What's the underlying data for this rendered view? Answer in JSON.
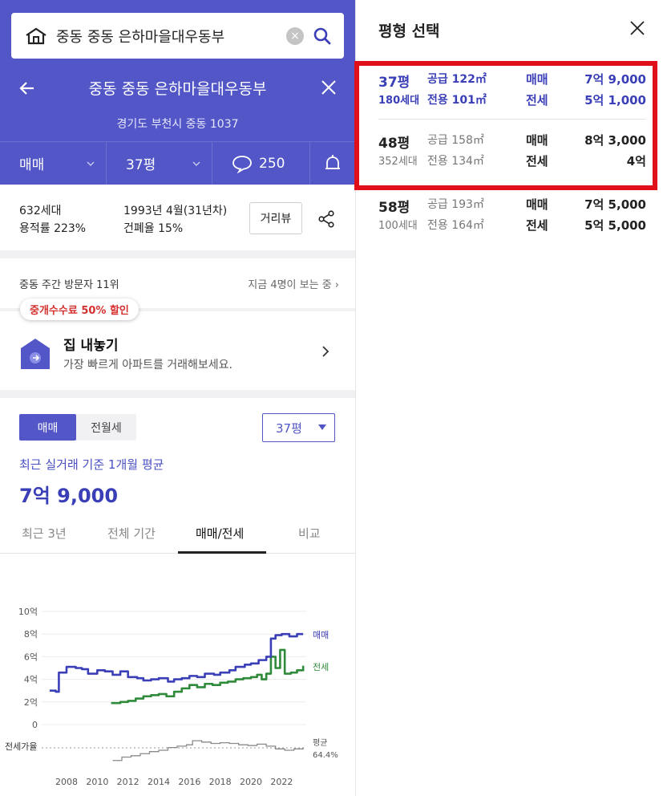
{
  "search": {
    "value": "중동 중동 은하마을대우동부",
    "clear_icon": "×"
  },
  "header": {
    "title": "중동 중동 은하마을대우동부",
    "address": "경기도 부천시 중동 1037"
  },
  "filters": {
    "trade": "매매",
    "size": "평",
    "size_num": "37",
    "comments": "250"
  },
  "complex_info": {
    "households": "632세대",
    "far": "용적률 223%",
    "built": "1993년 4월(31년차)",
    "bcr": "건폐율 15%",
    "street_view": "거리뷰"
  },
  "visitors": {
    "weekly": "중동 주간 방문자 11위",
    "now": "지금 4명이 보는 중"
  },
  "promo": {
    "badge": "중개수수료 50% 할인",
    "title": "집 내놓기",
    "subtitle": "가장 빠르게 아파트를 거래해보세요."
  },
  "market": {
    "seg_active": "매매",
    "seg_other": "전월세",
    "pyeong_select": "37평",
    "avg_label": "최근 실거래 기준 1개월 평균",
    "avg_price": "7억 9,000",
    "tabs": [
      "최근 3년",
      "전체 기간",
      "매매/전세",
      "비교"
    ]
  },
  "chart_data": {
    "type": "line",
    "y_ticks": [
      "10억",
      "8억",
      "6억",
      "4억",
      "2억",
      "0"
    ],
    "x_ticks": [
      "2008",
      "2010",
      "2012",
      "2014",
      "2016",
      "2018",
      "2020",
      "2022"
    ],
    "ylim": [
      0,
      10
    ],
    "xlim": [
      2006.8,
      2023.6
    ],
    "series": [
      {
        "name": "매매",
        "color": "#3b3fb7",
        "x": [
          2006.9,
          2007.3,
          2007.5,
          2008.0,
          2008.6,
          2009.0,
          2009.4,
          2010.0,
          2010.5,
          2011.0,
          2011.5,
          2012.0,
          2012.6,
          2013.0,
          2013.5,
          2014.0,
          2014.6,
          2015.0,
          2015.5,
          2016.0,
          2016.5,
          2017.0,
          2017.6,
          2018.0,
          2018.6,
          2019.0,
          2019.6,
          2020.0,
          2020.5,
          2021.0,
          2021.3,
          2021.6,
          2022.0,
          2022.5,
          2023.0,
          2023.4
        ],
        "values": [
          3.0,
          2.9,
          4.6,
          5.1,
          5.0,
          4.9,
          4.5,
          4.8,
          4.7,
          4.4,
          4.7,
          4.2,
          4.1,
          3.9,
          4.0,
          4.1,
          3.8,
          4.0,
          4.1,
          4.3,
          4.2,
          4.5,
          4.4,
          4.6,
          4.8,
          5.1,
          5.3,
          5.4,
          5.7,
          6.0,
          7.6,
          7.9,
          8.0,
          7.8,
          8.0,
          8.0
        ]
      },
      {
        "name": "전세",
        "color": "#2f8a3a",
        "x": [
          2010.9,
          2011.5,
          2012.0,
          2012.5,
          2013.0,
          2013.5,
          2014.0,
          2014.5,
          2015.0,
          2015.5,
          2016.0,
          2016.5,
          2017.0,
          2017.5,
          2018.0,
          2018.5,
          2019.0,
          2019.5,
          2020.0,
          2020.4,
          2020.7,
          2021.0,
          2021.3,
          2021.6,
          2021.9,
          2022.2,
          2022.6,
          2023.0,
          2023.4
        ],
        "values": [
          1.9,
          2.0,
          2.1,
          2.3,
          2.5,
          2.6,
          2.7,
          2.5,
          2.9,
          3.2,
          3.5,
          3.3,
          3.6,
          3.5,
          3.7,
          3.8,
          4.0,
          4.1,
          4.2,
          4.4,
          4.0,
          4.5,
          6.0,
          5.0,
          6.6,
          4.5,
          4.6,
          4.8,
          5.2
        ]
      },
      {
        "name": "전세가율",
        "color": "#8a8a8a",
        "x": [
          2011.0,
          2011.6,
          2012.2,
          2012.8,
          2013.4,
          2014.0,
          2014.6,
          2015.2,
          2015.8,
          2016.2,
          2016.8,
          2017.4,
          2018.0,
          2018.6,
          2019.2,
          2019.8,
          2020.4,
          2021.0,
          2021.6,
          2022.2,
          2022.8,
          2023.4
        ],
        "values": [
          45,
          50,
          52,
          55,
          58,
          60,
          64,
          66,
          68,
          74,
          72,
          70,
          71,
          70,
          68,
          67,
          69,
          66,
          62,
          60,
          62,
          64
        ]
      }
    ],
    "right_labels": {
      "sale": "매매",
      "jeonse": "전세",
      "ratio_left": "전세가율",
      "ratio_right_1": "평균",
      "ratio_right_2": "64.4%"
    }
  },
  "panel": {
    "title": "평형 선택",
    "rows": [
      {
        "py": "37평",
        "hh": "180세대",
        "supply": "공급 122㎡",
        "exclusive": "전용 101㎡",
        "k1": "매매",
        "v1": "7억 9,000",
        "k2": "전세",
        "v2": "5억 1,000",
        "selected": true
      },
      {
        "py": "48평",
        "hh": "352세대",
        "supply": "공급 158㎡",
        "exclusive": "전용 134㎡",
        "k1": "매매",
        "v1": "8억 3,000",
        "k2": "전세",
        "v2": "4억",
        "selected": false
      },
      {
        "py": "58평",
        "hh": "100세대",
        "supply": "공급 193㎡",
        "exclusive": "전용 164㎡",
        "k1": "매매",
        "v1": "7억 5,000",
        "k2": "전세",
        "v2": "5억 5,000",
        "selected": false
      }
    ]
  },
  "colors": {
    "brand": "#5256c7",
    "highlight": "#e0101b"
  }
}
